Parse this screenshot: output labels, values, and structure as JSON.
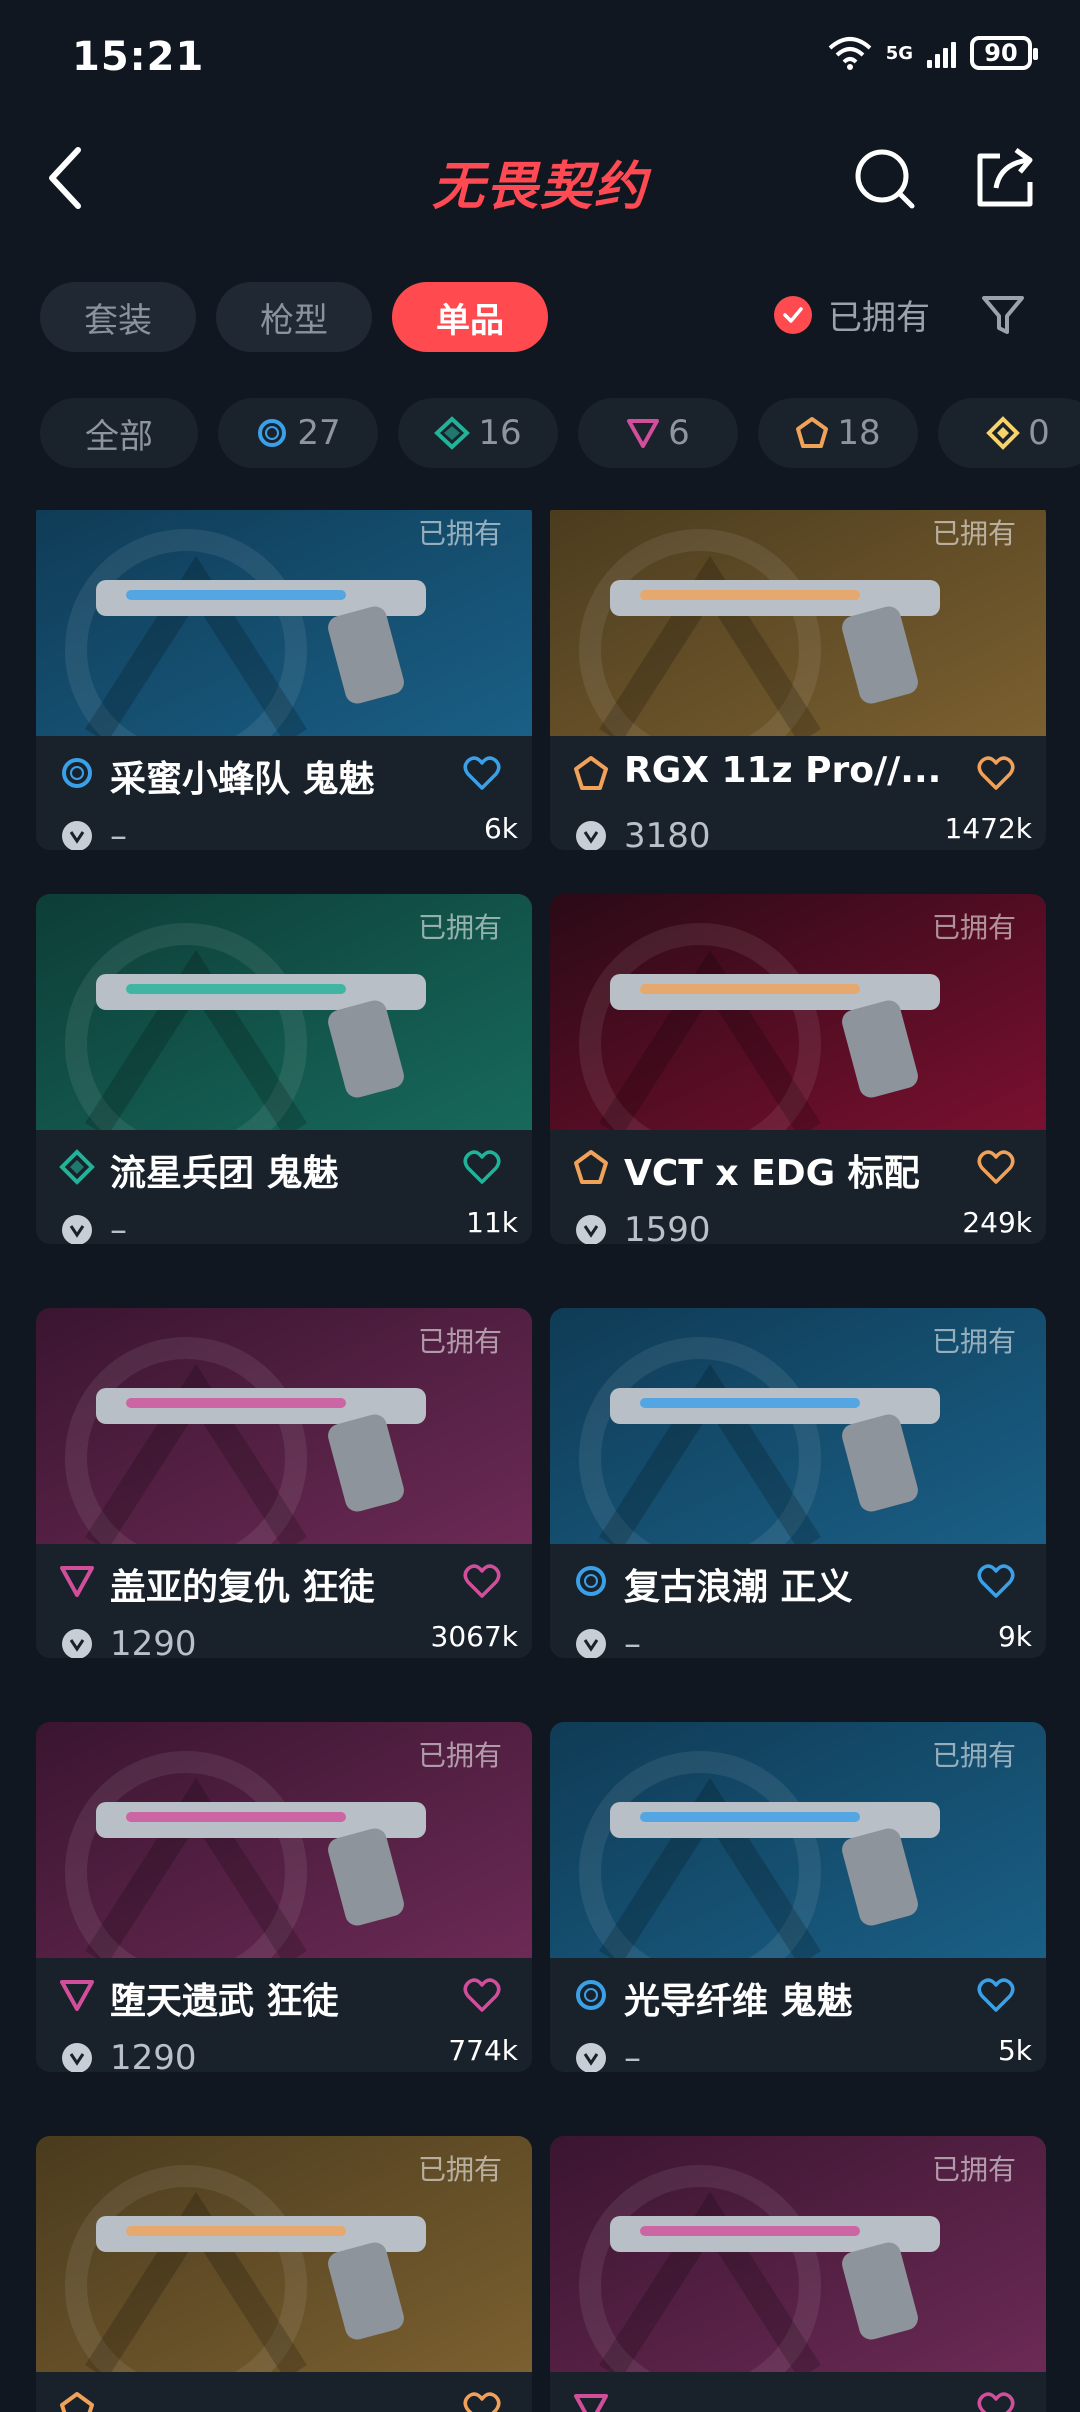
{
  "status": {
    "time": "15:21",
    "network": "5G",
    "battery": "90"
  },
  "header": {
    "title": "无畏契约"
  },
  "tabs": [
    {
      "label": "套装",
      "active": false
    },
    {
      "label": "枪型",
      "active": false
    },
    {
      "label": "单品",
      "active": true
    }
  ],
  "owned_filter": {
    "label": "已拥有",
    "checked": true
  },
  "rarity_chips": [
    {
      "label": "全部",
      "icon": "all"
    },
    {
      "count": "27",
      "icon": "select-circle-icon",
      "color": "#3aa0e8"
    },
    {
      "count": "16",
      "icon": "deluxe-diamond-icon",
      "color": "#21b399"
    },
    {
      "count": "6",
      "icon": "premium-triangle-icon",
      "color": "#d14f9a"
    },
    {
      "count": "18",
      "icon": "exclusive-pentagon-icon",
      "color": "#f0a259"
    },
    {
      "count": "0",
      "icon": "ultra-diamond-icon",
      "color": "#f7d36b"
    }
  ],
  "items": [
    {
      "name": "采蜜小蜂队 鬼魅",
      "price": "–",
      "likes": "6k",
      "owned": "已拥有",
      "rarity": "select",
      "theme": "blue"
    },
    {
      "name": "RGX 11z Pro//...",
      "price": "3180",
      "likes": "1472k",
      "owned": "已拥有",
      "rarity": "exclusive",
      "theme": "gold"
    },
    {
      "name": "流星兵团 鬼魅",
      "price": "–",
      "likes": "11k",
      "owned": "已拥有",
      "rarity": "deluxe",
      "theme": "teal"
    },
    {
      "name": "VCT x EDG 标配",
      "price": "1590",
      "likes": "249k",
      "owned": "已拥有",
      "rarity": "exclusive",
      "theme": "red"
    },
    {
      "name": "盖亚的复仇 狂徒",
      "price": "1290",
      "likes": "3067k",
      "owned": "已拥有",
      "rarity": "premium",
      "theme": "pink"
    },
    {
      "name": "复古浪潮 正义",
      "price": "–",
      "likes": "9k",
      "owned": "已拥有",
      "rarity": "select",
      "theme": "blue"
    },
    {
      "name": "堕天遗武 狂徒",
      "price": "1290",
      "likes": "774k",
      "owned": "已拥有",
      "rarity": "premium",
      "theme": "pink"
    },
    {
      "name": "光导纤维 鬼魅",
      "price": "–",
      "likes": "5k",
      "owned": "已拥有",
      "rarity": "select",
      "theme": "blue"
    },
    {
      "name": "",
      "price": "",
      "likes": "",
      "owned": "已拥有",
      "rarity": "exclusive",
      "theme": "gold"
    },
    {
      "name": "",
      "price": "",
      "likes": "",
      "owned": "已拥有",
      "rarity": "premium",
      "theme": "pink"
    }
  ],
  "colors": {
    "accent": "#ff4b50",
    "select": "#3aa0e8",
    "deluxe": "#21b399",
    "premium": "#d14f9a",
    "exclusive": "#f0a259"
  }
}
